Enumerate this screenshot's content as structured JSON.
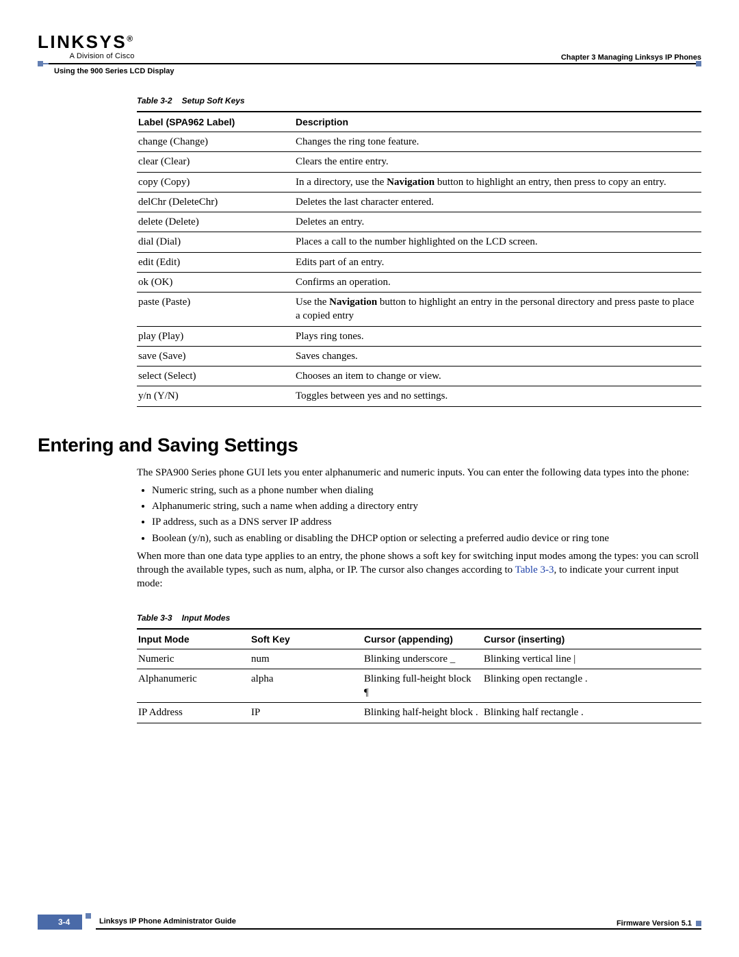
{
  "header": {
    "logo_main": "LINKSYS",
    "logo_reg": "®",
    "logo_sub": "A Division of Cisco",
    "chapter_label": "Chapter 3      Managing Linksys IP Phones",
    "section_ref": "Using the 900 Series LCD Display"
  },
  "table32": {
    "caption_num": "Table 3-2",
    "caption_title": "Setup Soft Keys",
    "col_label": "Label (SPA962 Label)",
    "col_desc": "Description",
    "rows": [
      {
        "label": "change (Change)",
        "desc": "Changes the ring tone feature."
      },
      {
        "label": "clear (Clear)",
        "desc": "Clears the entire entry."
      },
      {
        "label": "copy (Copy)",
        "desc_pre": "In a directory, use the ",
        "desc_bold": "Navigation",
        "desc_post": " button to highlight an entry, then press to copy an entry."
      },
      {
        "label": "delChr (DeleteChr)",
        "desc": "Deletes the last character entered."
      },
      {
        "label": "delete (Delete)",
        "desc": "Deletes an entry."
      },
      {
        "label": "dial (Dial)",
        "desc": "Places a call to the number highlighted on the LCD screen."
      },
      {
        "label": "edit (Edit)",
        "desc": "Edits part of an entry."
      },
      {
        "label": "ok (OK)",
        "desc": "Confirms an operation."
      },
      {
        "label": "paste (Paste)",
        "desc_pre": "Use the ",
        "desc_bold": "Navigation",
        "desc_post": " button to highlight an entry in the personal directory and press paste to place a copied entry"
      },
      {
        "label": "play (Play)",
        "desc": "Plays ring tones."
      },
      {
        "label": "save (Save)",
        "desc": "Saves changes."
      },
      {
        "label": "select (Select)",
        "desc": "Chooses an item to change or view."
      },
      {
        "label": "y/n (Y/N)",
        "desc": "Toggles between yes and no settings."
      }
    ]
  },
  "section": {
    "heading": "Entering and Saving Settings",
    "para1": "The SPA900 Series phone GUI lets you enter alphanumeric and numeric inputs. You can enter the following data types into the phone:",
    "bullets": [
      "Numeric string, such as a phone number when dialing",
      "Alphanumeric string, such a name when adding a directory entry",
      "IP address, such as a DNS server IP address",
      "Boolean (y/n), such as enabling or disabling the DHCP option or selecting a preferred audio device or ring tone"
    ],
    "para2_pre": "When more than one data type applies to an entry, the phone shows a soft key for switching input modes among the types: you can scroll through the available types, such as num, alpha, or IP. The cursor also changes according to ",
    "para2_link": "Table 3-3",
    "para2_post": ", to indicate your current input mode:"
  },
  "table33": {
    "caption_num": "Table 3-3",
    "caption_title": "Input Modes",
    "cols": [
      "Input Mode",
      "Soft Key",
      "Cursor (appending)",
      "Cursor (inserting)"
    ],
    "rows": [
      {
        "mode": "Numeric",
        "soft": "num",
        "app": "Blinking underscore _",
        "ins": "Blinking vertical line |"
      },
      {
        "mode": "Alphanumeric",
        "soft": "alpha",
        "app": "Blinking full-height block ¶",
        "ins": "Blinking open rectangle ."
      },
      {
        "mode": "IP Address",
        "soft": "IP",
        "app": "Blinking half-height block .",
        "ins": "Blinking half rectangle ."
      }
    ]
  },
  "footer": {
    "guide": "Linksys IP Phone Administrator Guide",
    "page": "3-4",
    "version": "Firmware Version 5.1"
  }
}
